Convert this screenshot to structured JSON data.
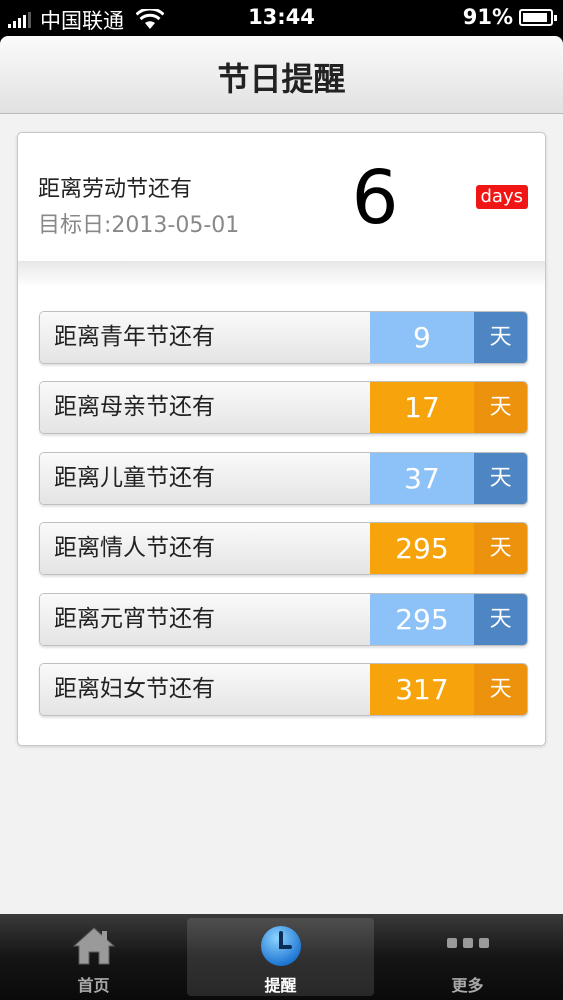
{
  "status_bar": {
    "carrier": "中国联通",
    "time": "13:44",
    "battery": "91%"
  },
  "nav": {
    "title": "节日提醒"
  },
  "hero": {
    "label": "距离劳动节还有",
    "target": "目标日:2013-05-01",
    "days": "6",
    "unit": "days"
  },
  "rows": [
    {
      "label": "距离青年节还有",
      "count": "9",
      "unit": "天"
    },
    {
      "label": "距离母亲节还有",
      "count": "17",
      "unit": "天"
    },
    {
      "label": "距离儿童节还有",
      "count": "37",
      "unit": "天"
    },
    {
      "label": "距离情人节还有",
      "count": "295",
      "unit": "天"
    },
    {
      "label": "距离元宵节还有",
      "count": "295",
      "unit": "天"
    },
    {
      "label": "距离妇女节还有",
      "count": "317",
      "unit": "天"
    }
  ],
  "tabs": [
    {
      "label": "首页",
      "icon": "home-icon"
    },
    {
      "label": "提醒",
      "icon": "clock-icon",
      "active": true
    },
    {
      "label": "更多",
      "icon": "more-icon"
    }
  ],
  "colors": {
    "blue_count": "#8cc2f7",
    "blue_unit": "#4e86c4",
    "orange_count": "#f7a30c",
    "orange_unit": "#ec920c",
    "badge": "#f01616"
  }
}
